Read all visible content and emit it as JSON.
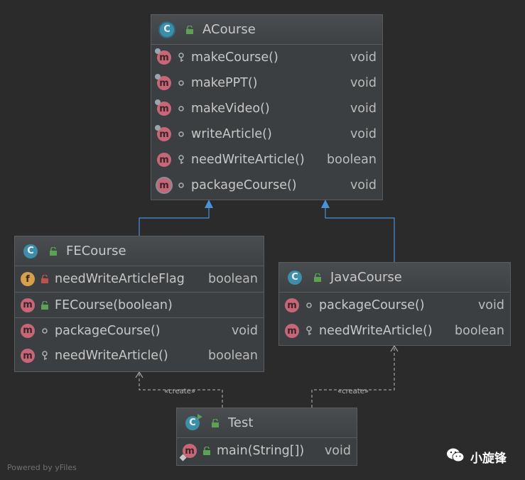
{
  "classes": {
    "acourse": {
      "name": "ACourse",
      "members": [
        {
          "icon": "m",
          "name": "makeCourse()",
          "type": "void"
        },
        {
          "icon": "m",
          "name": "makePPT()",
          "type": "void"
        },
        {
          "icon": "m",
          "name": "makeVideo()",
          "type": "void"
        },
        {
          "icon": "m",
          "name": "writeArticle()",
          "type": "void"
        },
        {
          "icon": "m",
          "name": "needWriteArticle()",
          "type": "boolean"
        },
        {
          "icon": "m",
          "name": "packageCourse()",
          "type": "void"
        }
      ]
    },
    "fecourse": {
      "name": "FECourse",
      "fields": [
        {
          "icon": "f",
          "name": "needWriteArticleFlag",
          "type": "boolean"
        }
      ],
      "constructors": [
        {
          "icon": "m",
          "name": "FECourse(boolean)",
          "type": ""
        }
      ],
      "methods": [
        {
          "icon": "m",
          "name": "packageCourse()",
          "type": "void"
        },
        {
          "icon": "m",
          "name": "needWriteArticle()",
          "type": "boolean"
        }
      ]
    },
    "javacourse": {
      "name": "JavaCourse",
      "methods": [
        {
          "icon": "m",
          "name": "packageCourse()",
          "type": "void"
        },
        {
          "icon": "m",
          "name": "needWriteArticle()",
          "type": "boolean"
        }
      ]
    },
    "test": {
      "name": "Test",
      "methods": [
        {
          "icon": "m",
          "name": "main(String[])",
          "type": "void"
        }
      ]
    }
  },
  "edges": {
    "create_label": "«create»"
  },
  "footer": {
    "watermark": "Powered by yFiles",
    "brand": "小旋锋"
  },
  "colors": {
    "background": "#2b2b2b",
    "inherit_arrow": "#4a90d9",
    "dependency_line": "#bbbbbb"
  }
}
